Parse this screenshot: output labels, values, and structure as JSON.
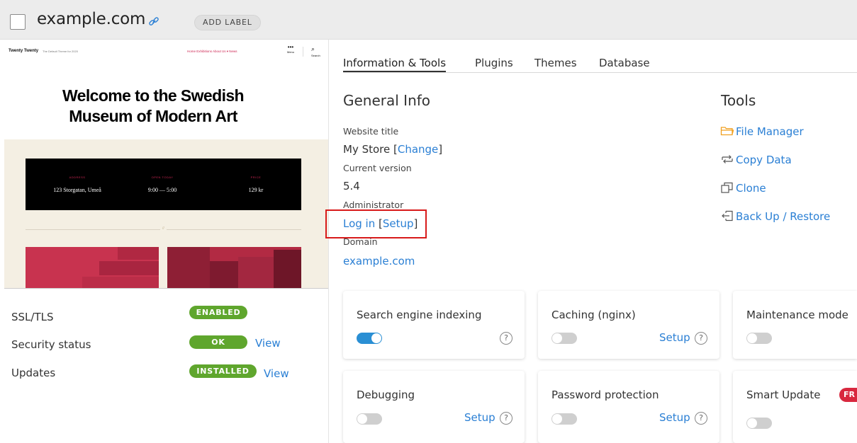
{
  "header": {
    "site_name": "example.com",
    "add_label": "ADD LABEL"
  },
  "preview": {
    "brand": "Twenty Twenty",
    "tagline": "The Default Theme for 2020",
    "nav": "Home   Exhibitions   About Us ▾   News",
    "menu_label": "Menu",
    "search_label": "Search",
    "headline_line1": "Welcome to the Swedish",
    "headline_line2": "Museum of Modern Art",
    "address_label": "ADDRESS",
    "address_value": "123 Storgatan, Umeå",
    "open_label": "OPEN TODAY",
    "open_value": "9:00 — 5:00",
    "price_label": "PRICE",
    "price_value": "129 kr"
  },
  "status": {
    "ssl_label": "SSL/TLS",
    "ssl_badge": "ENABLED",
    "security_label": "Security status",
    "security_badge": "OK",
    "security_view": "View",
    "updates_label": "Updates",
    "updates_badge": "INSTALLED",
    "updates_view": "View"
  },
  "tabs": [
    "Information & Tools",
    "Plugins",
    "Themes",
    "Database"
  ],
  "general_info": {
    "title": "General Info",
    "website_title_label": "Website title",
    "website_title_value": "My Store",
    "change_link": "Change",
    "version_label": "Current version",
    "version_value": "5.4",
    "admin_label": "Administrator",
    "login_link": "Log in",
    "setup_link": "Setup",
    "domain_label": "Domain",
    "domain_value": "example.com"
  },
  "tools": {
    "title": "Tools",
    "items": [
      {
        "label": "File Manager",
        "icon": "folder-icon"
      },
      {
        "label": "Copy Data",
        "icon": "copy-data-icon"
      },
      {
        "label": "Clone",
        "icon": "clone-icon"
      },
      {
        "label": "Back Up / Restore",
        "icon": "backup-icon"
      }
    ]
  },
  "cards": {
    "search_indexing": {
      "title": "Search engine indexing",
      "enabled": true
    },
    "caching": {
      "title": "Caching (nginx)",
      "setup": "Setup",
      "enabled": false
    },
    "maintenance": {
      "title": "Maintenance mode",
      "enabled": false
    },
    "debugging": {
      "title": "Debugging",
      "setup": "Setup",
      "enabled": false
    },
    "password": {
      "title": "Password protection",
      "setup": "Setup",
      "enabled": false
    },
    "smart_update": {
      "title": "Smart Update",
      "badge": "FR",
      "enabled": false
    },
    "help_glyph": "?"
  },
  "colors": {
    "accent_blue": "#2a7fd4",
    "badge_green": "#5fa62d",
    "highlight_red": "#d81a1a",
    "folder_orange": "#f0a020",
    "preview_pink": "#cd2653"
  }
}
